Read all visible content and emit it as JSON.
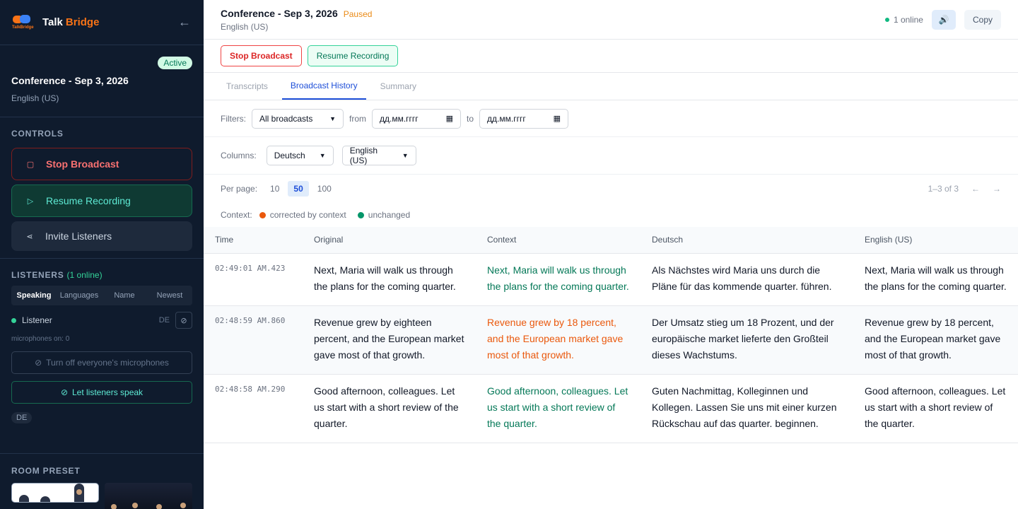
{
  "app": {
    "brand_a": "Talk",
    "brand_b": "Bridge",
    "logo_text": "TalkBridge"
  },
  "sidebar": {
    "status_badge": "Active",
    "conference_title": "Conference - Sep 3, 2026",
    "conference_language": "English (US)",
    "controls_heading": "CONTROLS",
    "stop_broadcast": "Stop Broadcast",
    "resume_recording": "Resume Recording",
    "invite_listeners": "Invite Listeners",
    "listeners_heading": "LISTENERS",
    "listeners_online": "(1 online)",
    "listener_tabs": [
      "Speaking",
      "Languages",
      "Name",
      "Newest"
    ],
    "listener": {
      "name": "Listener",
      "language": "DE"
    },
    "microphones_on": "microphones on: 0",
    "turn_off_mics": "Turn off everyone's microphones",
    "let_speak": "Let listeners speak",
    "language_chip": "DE",
    "room_preset_heading": "ROOM PRESET"
  },
  "header": {
    "title": "Conference - Sep 3, 2026",
    "status": "Paused",
    "language": "English (US)",
    "online": "1 online",
    "copy": "Copy",
    "speaker_icon": "speaker-icon"
  },
  "actions": {
    "stop": "Stop Broadcast",
    "resume": "Resume Recording"
  },
  "tabs": [
    "Transcripts",
    "Broadcast History",
    "Summary"
  ],
  "filters": {
    "label": "Filters:",
    "broadcast": "All broadcasts",
    "from_label": "from",
    "from_value": "дд.мм.гггг",
    "to_label": "to",
    "to_value": "дд.мм.гггг"
  },
  "columns": {
    "label": "Columns:",
    "col1": "Deutsch",
    "col2": "English (US)"
  },
  "paging": {
    "label": "Per page:",
    "options": [
      "10",
      "50",
      "100"
    ],
    "selected": "50",
    "range": "1–3 of 3",
    "prev": "←",
    "next": "→"
  },
  "legend": {
    "label": "Context:",
    "corrected": "corrected by context",
    "unchanged": "unchanged",
    "corrected_color": "#ea580c",
    "unchanged_color": "#059669"
  },
  "table": {
    "headers": [
      "Time",
      "Original",
      "Context",
      "Deutsch",
      "English (US)"
    ],
    "rows": [
      {
        "time": "02:49:01 AM.423",
        "original": "Next, Maria will walk us through the plans for the coming quarter.",
        "context": "Next, Maria will walk us through the plans for the coming quarter.",
        "deutsch": "Als Nächstes wird Maria uns durch die Pläne für das kommende quarter. führen.",
        "english": "Next, Maria will walk us through the plans for the coming quarter."
      },
      {
        "time": "02:48:59 AM.860",
        "original": "Revenue grew by eighteen percent, and the European market gave most of that growth.",
        "context": "Revenue grew by 18 percent, and the European market gave most of that growth.",
        "deutsch": "Der Umsatz stieg um 18 Prozent, und der europäische market lieferte den Großteil dieses Wachstums.",
        "english": "Revenue grew by 18 percent, and the European market gave most of that growth."
      },
      {
        "time": "02:48:58 AM.290",
        "original": "Good afternoon, colleagues. Let us start with a short review of the quarter.",
        "context": "Good afternoon, colleagues. Let us start with a short review of the quarter.",
        "deutsch": "Guten Nachmittag, Kolleginnen und Kollegen. Lassen Sie uns mit einer kurzen Rückschau auf das quarter. beginnen.",
        "english": "Good afternoon, colleagues. Let us start with a short review of the quarter."
      }
    ]
  }
}
